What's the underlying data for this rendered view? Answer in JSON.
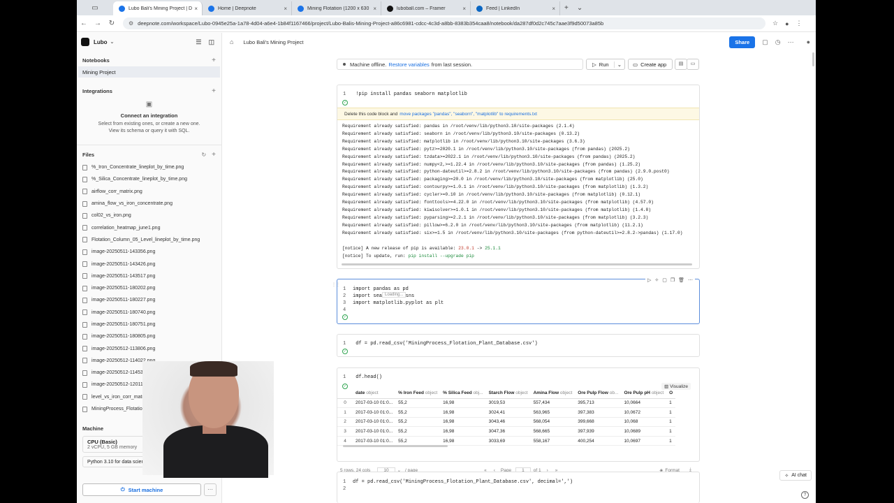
{
  "tabs": [
    {
      "label": "Lubo Bali's Mining Project | D",
      "color": "#1a73e8",
      "active": true
    },
    {
      "label": "Home | Deepnote",
      "color": "#1a73e8",
      "active": false
    },
    {
      "label": "Mining Flotation (1200 x 630",
      "color": "#1a73e8",
      "active": false
    },
    {
      "label": "luboball.com – Framer",
      "color": "#111111",
      "active": false
    },
    {
      "label": "Feed | LinkedIn",
      "color": "#0a66c2",
      "active": false
    }
  ],
  "url": "deepnote.com/workspace/Lubo-0945e25a-1a78-4d04-a6e4-1b84f1167466/project/Lubo-Balis-Mining-Project-a86c6981-cdcc-4c3d-a8bb-8383b354caa8/notebook/da287df0d2c745c7aae3f9d50073a85b",
  "workspace": "Lubo",
  "project_title": "Lubo Bali's Mining Project",
  "share_label": "Share",
  "sidebar": {
    "notebooks_header": "Notebooks",
    "notebook_item": "Mining Project",
    "integrations_header": "Integrations",
    "connect_title": "Connect an integration",
    "connect_desc1": "Select from existing ones, or create a new one.",
    "connect_desc2": "View its schema or query it with SQL.",
    "files_header": "Files",
    "files": [
      "%_Iron_Concentrate_lineplot_by_time.png",
      "%_Silica_Concentrate_lineplot_by_time.png",
      "airflow_corr_matrix.png",
      "amina_flow_vs_iron_concentrate.png",
      "col02_vs_iron.png",
      "correlation_heatmap_june1.png",
      "Flotation_Column_05_Level_lineplot_by_time.png",
      "image-20250511-143356.png",
      "image-20250511-143426.png",
      "image-20250511-143517.png",
      "image-20250511-180202.png",
      "image-20250511-180227.png",
      "image-20250511-180740.png",
      "image-20250511-180751.png",
      "image-20250511-180805.png",
      "image-20250512-113806.png",
      "image-20250512-114022.png",
      "image-20250512-114532.png",
      "image-20250512-120113.png",
      "level_vs_iron_corr_matrix.png",
      "MiningProcess_Flotation_Plant_Database.csv"
    ],
    "machine_header": "Machine",
    "machine_name": "CPU (Basic)",
    "machine_spec": "2 vCPU, 5 GB memory",
    "python_version": "Python 3.10 for data science",
    "start_machine": "Start machine"
  },
  "status": {
    "text1": "Machine offline.",
    "link": "Restore variables",
    "text2": "from last session."
  },
  "run_label": "Run",
  "create_app_label": "Create app",
  "cell1": {
    "code": "!pip install pandas seaborn matplotlib",
    "warn_text": "Delete this code block and",
    "warn_link": "move packages \"pandas\", \"seaborn\", \"matplotlib\" to requirements.txt",
    "output": [
      "Requirement already satisfied: pandas in /root/venv/lib/python3.10/site-packages (2.1.4)",
      "Requirement already satisfied: seaborn in /root/venv/lib/python3.10/site-packages (0.13.2)",
      "Requirement already satisfied: matplotlib in /root/venv/lib/python3.10/site-packages (3.6.3)",
      "Requirement already satisfied: pytz>=2020.1 in /root/venv/lib/python3.10/site-packages (from pandas) (2025.2)",
      "Requirement already satisfied: tzdata>=2022.1 in /root/venv/lib/python3.10/site-packages (from pandas) (2025.2)",
      "Requirement already satisfied: numpy<2,>=1.22.4 in /root/venv/lib/python3.10/site-packages (from pandas) (1.25.2)",
      "Requirement already satisfied: python-dateutil>=2.8.2 in /root/venv/lib/python3.10/site-packages (from pandas) (2.9.0.post0)",
      "Requirement already satisfied: packaging>=20.0 in /root/venv/lib/python3.10/site-packages (from matplotlib) (25.0)",
      "Requirement already satisfied: contourpy>=1.0.1 in /root/venv/lib/python3.10/site-packages (from matplotlib) (1.3.2)",
      "Requirement already satisfied: cycler>=0.10 in /root/venv/lib/python3.10/site-packages (from matplotlib) (0.12.1)",
      "Requirement already satisfied: fonttools>=4.22.0 in /root/venv/lib/python3.10/site-packages (from matplotlib) (4.57.0)",
      "Requirement already satisfied: kiwisolver>=1.0.1 in /root/venv/lib/python3.10/site-packages (from matplotlib) (1.4.8)",
      "Requirement already satisfied: pyparsing>=2.2.1 in /root/venv/lib/python3.10/site-packages (from matplotlib) (3.2.3)",
      "Requirement already satisfied: pillow>=6.2.0 in /root/venv/lib/python3.10/site-packages (from matplotlib) (11.2.1)",
      "Requirement already satisfied: six>=1.5 in /root/venv/lib/python3.10/site-packages (from python-dateutil>=2.8.2->pandas) (1.17.0)"
    ],
    "notice1_a": "[notice] A new release of pip is available: ",
    "notice1_old": "23.0.1",
    "notice1_arrow": " -> ",
    "notice1_new": "25.1.1",
    "notice2_a": "[notice] To update, run: ",
    "notice2_cmd": "pip install --upgrade pip"
  },
  "cell2": {
    "lines": [
      "import pandas as pd",
      "import seaborn as sns",
      "import matplotlib.pyplot as plt",
      ""
    ],
    "loading": "Loading..."
  },
  "cell3": {
    "code": "df = pd.read_csv('MiningProcess_Flotation_Plant_Database.csv')"
  },
  "cell4": {
    "code": "df.head()",
    "visualize": "Visualize",
    "columns": [
      {
        "name": "date",
        "type": "object"
      },
      {
        "name": "% Iron Feed",
        "type": "object"
      },
      {
        "name": "% Silica Feed",
        "type": "obj..."
      },
      {
        "name": "Starch Flow",
        "type": "object"
      },
      {
        "name": "Amina Flow",
        "type": "object"
      },
      {
        "name": "Ore Pulp Flow",
        "type": "ob..."
      },
      {
        "name": "Ore Pulp pH",
        "type": "object"
      },
      {
        "name": "O",
        "type": ""
      }
    ],
    "rows": [
      [
        "0",
        "2017-03-10 01:0...",
        "55,2",
        "16,98",
        "3019,53",
        "557,434",
        "395,713",
        "10,0664",
        "1"
      ],
      [
        "1",
        "2017-03-10 01:0...",
        "55,2",
        "16,98",
        "3024,41",
        "563,965",
        "397,383",
        "10,0672",
        "1"
      ],
      [
        "2",
        "2017-03-10 01:0...",
        "55,2",
        "16,98",
        "3043,46",
        "568,054",
        "399,668",
        "10,068",
        "1"
      ],
      [
        "3",
        "2017-03-10 01:0...",
        "55,2",
        "16,98",
        "3047,36",
        "568,665",
        "397,939",
        "10,0689",
        "1"
      ],
      [
        "4",
        "2017-03-10 01:0...",
        "55,2",
        "16,98",
        "3033,69",
        "558,167",
        "400,254",
        "10,0697",
        "1"
      ]
    ],
    "summary": "5 rows, 24 cols",
    "per_page": "10",
    "per_page_label": "/ page",
    "page_label": "Page",
    "page_value": "1",
    "page_of": "of 1",
    "format_label": "Format"
  },
  "cell5": {
    "code": "df = pd.read_csv('MiningProcess_Flotation_Plant_Database.csv', decimal=',')"
  },
  "ai_chat": "AI chat"
}
